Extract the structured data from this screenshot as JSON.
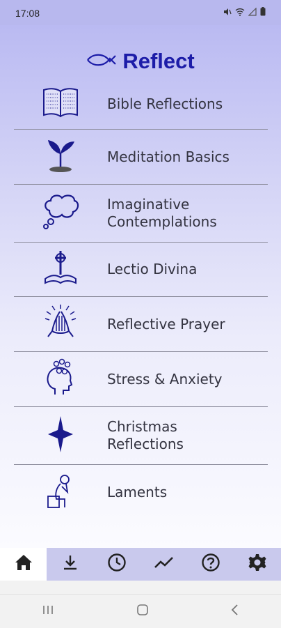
{
  "status_bar": {
    "time": "17:08",
    "icons": [
      "mute-icon",
      "wifi-icon",
      "signal-icon",
      "battery-icon"
    ]
  },
  "header": {
    "title": "Reflect",
    "logo_icon": "ichthys-fish-icon"
  },
  "menu": {
    "items": [
      {
        "label": "Bible Reflections",
        "icon": "open-bible-icon"
      },
      {
        "label": "Meditation Basics",
        "icon": "sprout-icon"
      },
      {
        "label": "Imaginative\nContemplations",
        "icon": "thought-bubble-icon"
      },
      {
        "label": "Lectio Divina",
        "icon": "celtic-cross-bible-icon"
      },
      {
        "label": "Reflective Prayer",
        "icon": "praying-hands-icon"
      },
      {
        "label": "Stress & Anxiety",
        "icon": "head-gears-icon"
      },
      {
        "label": "Christmas\nReflections",
        "icon": "star-icon"
      },
      {
        "label": "Laments",
        "icon": "grieving-person-icon"
      }
    ]
  },
  "bottom_tabs": [
    {
      "icon": "home-icon",
      "active": true
    },
    {
      "icon": "download-icon",
      "active": false
    },
    {
      "icon": "history-clock-icon",
      "active": false
    },
    {
      "icon": "progress-chart-icon",
      "active": false
    },
    {
      "icon": "help-icon",
      "active": false
    },
    {
      "icon": "settings-gear-icon",
      "active": false
    }
  ],
  "colors": {
    "accent": "#1c1ca8",
    "icon": "#1a1a8c",
    "tab_bar": "#c9c9ed"
  }
}
